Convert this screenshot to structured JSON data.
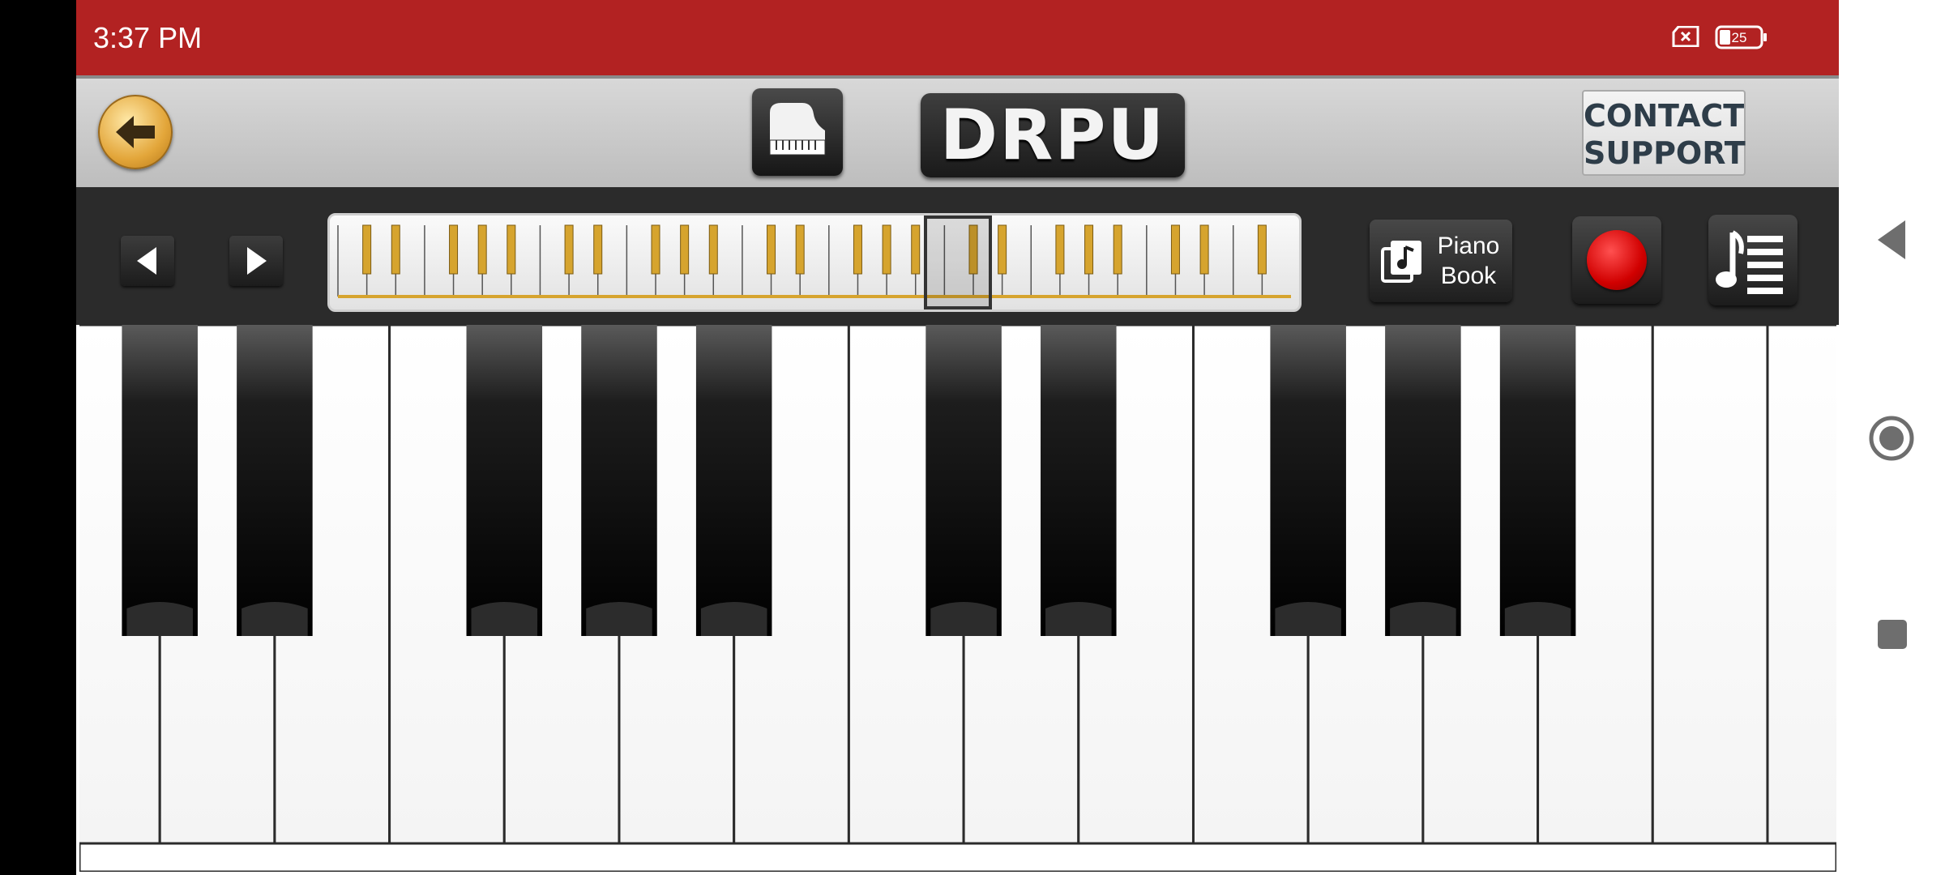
{
  "status_bar": {
    "time": "3:37 PM",
    "battery_level": "25",
    "background_color": "#b22222",
    "icons": [
      "no-sim-icon",
      "battery-icon"
    ]
  },
  "toolbar": {
    "back_icon": "arrow-left-icon",
    "piano_icon": "grand-piano-icon",
    "logo_text": "DRPU",
    "contact_label": "CONTACT\nSUPPORT"
  },
  "control_bar": {
    "prev_icon": "triangle-left-icon",
    "next_icon": "triangle-right-icon",
    "piano_book_label": "Piano\nBook",
    "piano_book_icon": "music-note-book-icon",
    "record_icon": "record-icon",
    "record_color": "#e00000",
    "songs_icon": "music-note-list-icon",
    "mini_keyboard_white_keys": 33,
    "mini_key_color": "#d6a42e"
  },
  "keyboard": {
    "white_keys": 15,
    "black_key_pattern": [
      1,
      1,
      0,
      1,
      1,
      1,
      0,
      1,
      1,
      0,
      1,
      1,
      1,
      0
    ]
  },
  "android_nav": {
    "icons": [
      "back-triangle-icon",
      "home-circle-icon",
      "recents-square-icon"
    ]
  }
}
